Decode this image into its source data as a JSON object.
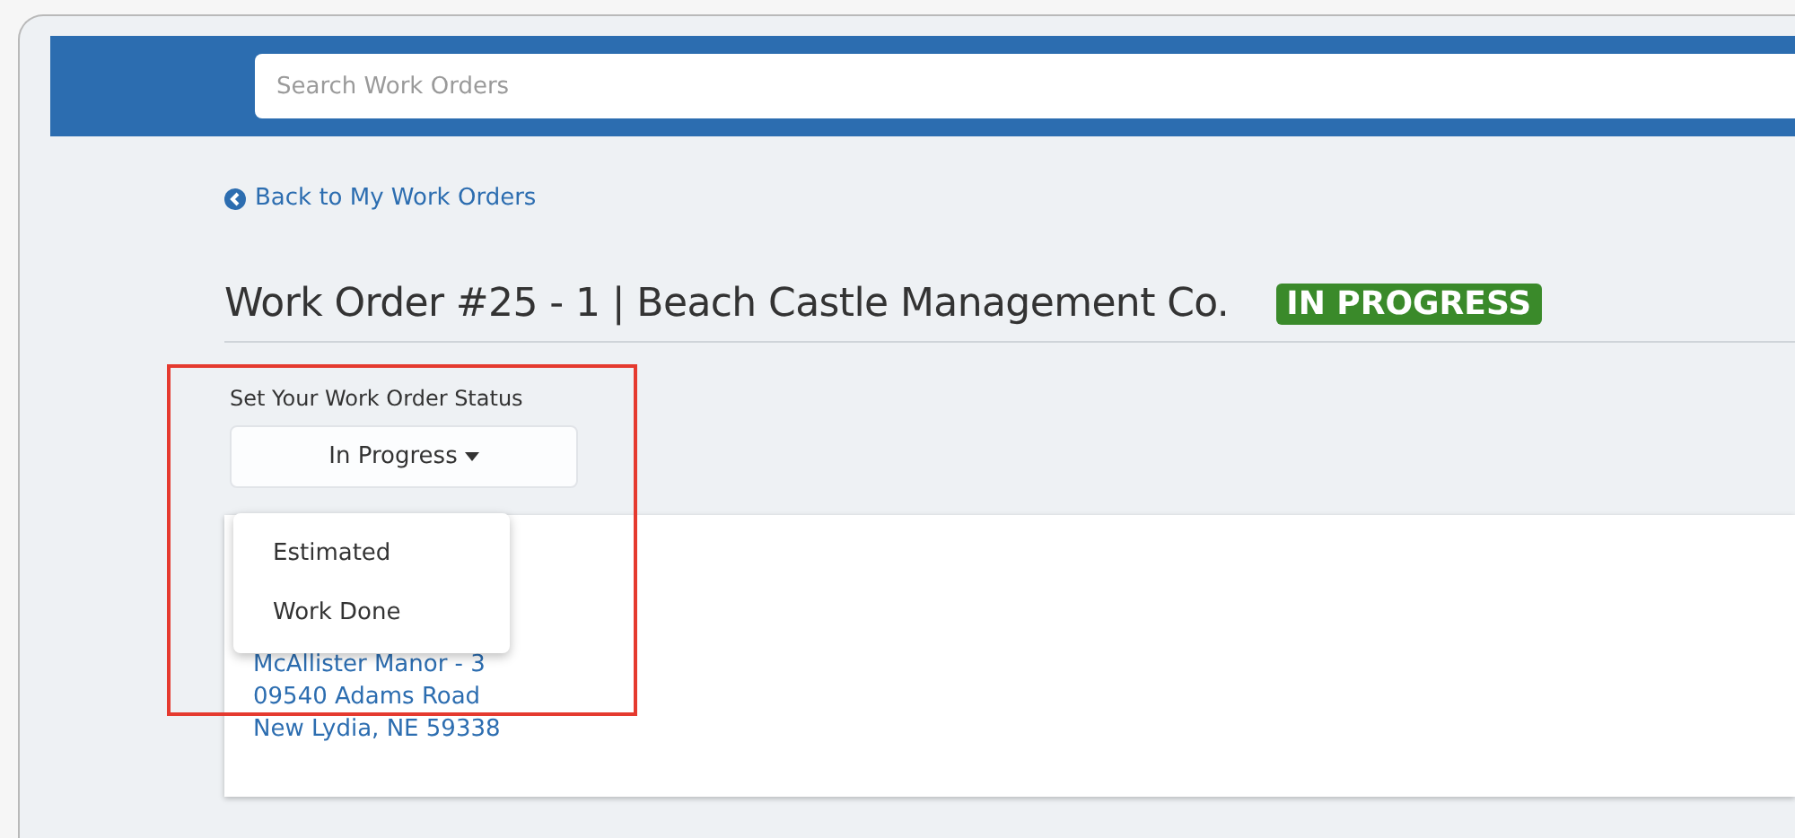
{
  "search": {
    "placeholder": "Search Work Orders"
  },
  "back_link": {
    "label": "Back to My Work Orders"
  },
  "title": "Work Order #25 - 1 | Beach Castle Management Co.",
  "status_badge": {
    "label": "IN PROGRESS",
    "color": "#3a8a2a"
  },
  "status_control": {
    "label": "Set Your Work Order Status",
    "value": "In Progress",
    "expanded": true,
    "options": [
      {
        "label": "Estimated",
        "selected": false
      },
      {
        "label": "Work Done",
        "selected": false
      }
    ]
  },
  "address": [
    "McAllister Manor - 3",
    "09540 Adams Road",
    "New Lydia, NE 59338"
  ],
  "annotation": {
    "kind": "highlight",
    "color": "#e53a2f"
  }
}
